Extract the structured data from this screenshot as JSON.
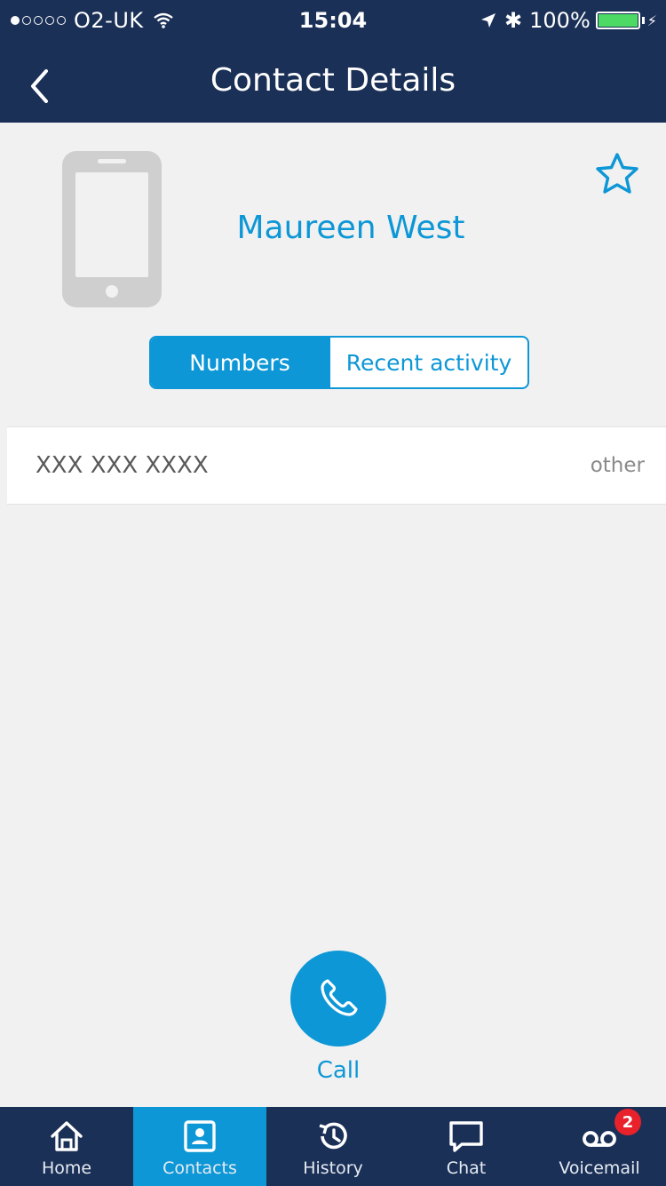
{
  "status_bar": {
    "carrier": "O2-UK",
    "time": "15:04",
    "battery": "100%",
    "signal_bars_filled": 1,
    "signal_bars_total": 5
  },
  "header": {
    "title": "Contact Details",
    "back_icon": "chevron-left-icon"
  },
  "contact": {
    "name": "Maureen West",
    "avatar_icon": "mobile-phone-icon",
    "favorite_icon": "star-outline-icon"
  },
  "segments": {
    "numbers_label": "Numbers",
    "recent_label": "Recent activity",
    "selected": "Numbers"
  },
  "numbers": [
    {
      "value": "XXX XXX XXXX",
      "type": "other"
    }
  ],
  "call": {
    "label": "Call",
    "icon": "phone-handset-icon"
  },
  "tabs": [
    {
      "label": "Home",
      "icon": "home-icon"
    },
    {
      "label": "Contacts",
      "icon": "contacts-icon"
    },
    {
      "label": "History",
      "icon": "history-icon"
    },
    {
      "label": "Chat",
      "icon": "chat-bubble-icon"
    },
    {
      "label": "Voicemail",
      "icon": "voicemail-icon",
      "badge": "2"
    }
  ],
  "colors": {
    "header_bg": "#1b3057",
    "accent": "#0d97d6",
    "badge": "#e8212a",
    "background": "#f1f1f1"
  }
}
